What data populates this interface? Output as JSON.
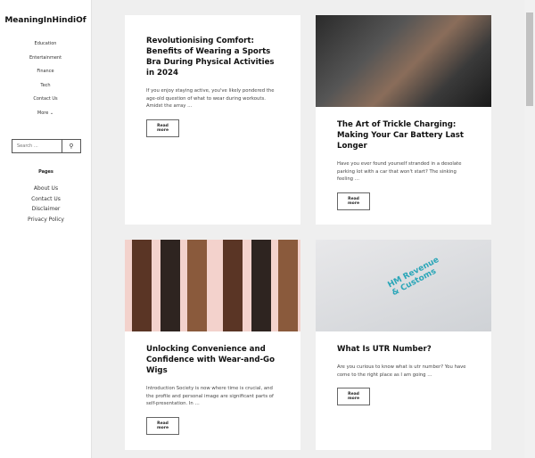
{
  "site": {
    "logo": "MeaningInHindiOf"
  },
  "nav": [
    "Education",
    "Entertainment",
    "Finance",
    "Tech",
    "Contact Us",
    "More ⌄"
  ],
  "search": {
    "placeholder": "Search …",
    "icon": "search-icon"
  },
  "pages": {
    "heading": "Pages",
    "items": [
      "About Us",
      "Contact Us",
      "Disclaimer",
      "Privacy Policy"
    ]
  },
  "posts": [
    {
      "title": "Revolutionising Comfort: Benefits of Wearing a Sports Bra During Physical Activities in 2024",
      "excerpt": "If you enjoy staying active, you've likely pondered the age-old question of what to wear during workouts. Amidst the array …",
      "button": "Read more"
    },
    {
      "title": "The Art of Trickle Charging: Making Your Car Battery Last Longer",
      "excerpt": "Have you ever found yourself stranded in a desolate parking lot with a car that won't start? The sinking feeling …",
      "button": "Read more"
    },
    {
      "title": "Unlocking Convenience and Confidence with Wear-and-Go Wigs",
      "excerpt": "Introduction Society is now where time is crucial, and the profile and personal image are significant parts of self-presentation. In …",
      "button": "Read more"
    },
    {
      "title": "What Is UTR Number?",
      "excerpt": "Are you curious to know what is utr number? You have come to the right place as I am going …",
      "button": "Read more",
      "image_text": "HM Revenue & Customs"
    }
  ]
}
